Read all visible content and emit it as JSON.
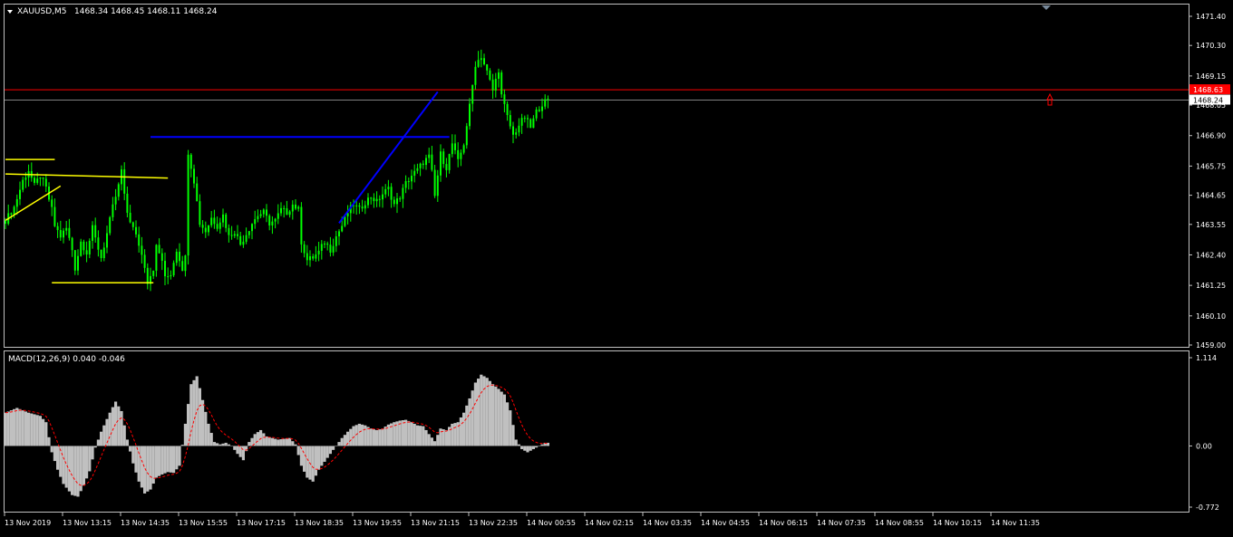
{
  "header": {
    "symbol": "XAUUSD,M5",
    "ohlc": "1468.34 1468.45 1468.11 1468.24"
  },
  "macd_header": {
    "label": "MACD(12,26,9) 0.040 -0.046"
  },
  "colors": {
    "background": "#000000",
    "frame": "#c0c0c0",
    "candle": "#00ff00",
    "yellow_lines": "#ffff00",
    "blue_lines": "#0000ff",
    "ask_line": "#ff0000",
    "hist": "#c0c0c0",
    "signal": "#ff0000"
  },
  "price_axis": {
    "ticks": [
      "1471.40",
      "1470.30",
      "1469.15",
      "1468.05",
      "1466.90",
      "1465.75",
      "1464.65",
      "1463.55",
      "1462.40",
      "1461.25",
      "1460.10",
      "1459.00"
    ],
    "bid_label": "1468.24",
    "ask_label": "1468.63",
    "bid": 1468.24,
    "ask": 1468.63
  },
  "macd_axis": {
    "ticks": [
      "1.114",
      "0.00",
      "-0.772"
    ],
    "max": 1.114,
    "min": -0.772
  },
  "time_axis": {
    "labels": [
      "13 Nov 2019",
      "13 Nov 13:15",
      "13 Nov 14:35",
      "13 Nov 15:55",
      "13 Nov 17:15",
      "13 Nov 18:35",
      "13 Nov 19:55",
      "13 Nov 21:15",
      "13 Nov 22:35",
      "14 Nov 00:55",
      "14 Nov 02:15",
      "14 Nov 03:35",
      "14 Nov 04:55",
      "14 Nov 06:15",
      "14 Nov 07:35",
      "14 Nov 08:55",
      "14 Nov 10:15",
      "14 Nov 11:35"
    ]
  },
  "chart_data": {
    "type": "candlestick",
    "price_range": [
      1459.0,
      1471.4
    ],
    "close_path": [
      [
        0,
        1463.7
      ],
      [
        3,
        1464.2
      ],
      [
        6,
        1465.2
      ],
      [
        8,
        1465.6
      ],
      [
        10,
        1465.0
      ],
      [
        12,
        1465.4
      ],
      [
        14,
        1464.9
      ],
      [
        16,
        1464.1
      ],
      [
        17,
        1463.5
      ],
      [
        19,
        1463.1
      ],
      [
        21,
        1463.4
      ],
      [
        23,
        1462.6
      ],
      [
        24,
        1461.9
      ],
      [
        26,
        1462.9
      ],
      [
        28,
        1462.5
      ],
      [
        30,
        1463.4
      ],
      [
        31,
        1463.0
      ],
      [
        33,
        1462.3
      ],
      [
        35,
        1463.2
      ],
      [
        37,
        1464.2
      ],
      [
        39,
        1465.0
      ],
      [
        40,
        1465.6
      ],
      [
        41,
        1464.6
      ],
      [
        42,
        1464.0
      ],
      [
        44,
        1463.4
      ],
      [
        46,
        1462.8
      ],
      [
        48,
        1462.0
      ],
      [
        49,
        1461.4
      ],
      [
        51,
        1461.9
      ],
      [
        52,
        1462.7
      ],
      [
        54,
        1462.2
      ],
      [
        55,
        1461.5
      ],
      [
        57,
        1461.7
      ],
      [
        59,
        1462.6
      ],
      [
        61,
        1461.9
      ],
      [
        62,
        1462.3
      ],
      [
        63,
        1466.3
      ],
      [
        65,
        1465.2
      ],
      [
        67,
        1463.6
      ],
      [
        69,
        1463.3
      ],
      [
        71,
        1463.8
      ],
      [
        73,
        1463.5
      ],
      [
        75,
        1463.9
      ],
      [
        77,
        1463.1
      ],
      [
        79,
        1463.3
      ],
      [
        81,
        1462.8
      ],
      [
        83,
        1463.2
      ],
      [
        85,
        1463.6
      ],
      [
        87,
        1463.9
      ],
      [
        89,
        1464.0
      ],
      [
        91,
        1463.6
      ],
      [
        93,
        1463.7
      ],
      [
        95,
        1464.1
      ],
      [
        97,
        1464.0
      ],
      [
        99,
        1464.3
      ],
      [
        101,
        1464.1
      ],
      [
        102,
        1462.9
      ],
      [
        104,
        1462.2
      ],
      [
        106,
        1462.3
      ],
      [
        108,
        1462.5
      ],
      [
        110,
        1462.9
      ],
      [
        112,
        1462.6
      ],
      [
        114,
        1463.1
      ],
      [
        116,
        1463.5
      ],
      [
        118,
        1464.0
      ],
      [
        120,
        1464.3
      ],
      [
        122,
        1464.1
      ],
      [
        124,
        1464.4
      ],
      [
        126,
        1464.6
      ],
      [
        128,
        1464.4
      ],
      [
        130,
        1464.7
      ],
      [
        132,
        1464.9
      ],
      [
        134,
        1464.3
      ],
      [
        136,
        1464.6
      ],
      [
        138,
        1465.1
      ],
      [
        140,
        1465.4
      ],
      [
        142,
        1465.6
      ],
      [
        144,
        1465.9
      ],
      [
        146,
        1466.1
      ],
      [
        147,
        1465.5
      ],
      [
        148,
        1464.6
      ],
      [
        150,
        1466.2
      ],
      [
        152,
        1465.7
      ],
      [
        154,
        1466.6
      ],
      [
        156,
        1465.9
      ],
      [
        158,
        1466.6
      ],
      [
        160,
        1468.0
      ],
      [
        162,
        1469.6
      ],
      [
        164,
        1469.9
      ],
      [
        166,
        1469.3
      ],
      [
        168,
        1468.6
      ],
      [
        170,
        1469.4
      ],
      [
        171,
        1468.4
      ],
      [
        173,
        1467.6
      ],
      [
        175,
        1466.9
      ],
      [
        177,
        1467.3
      ],
      [
        179,
        1467.6
      ],
      [
        181,
        1467.2
      ],
      [
        183,
        1467.8
      ],
      [
        185,
        1468.1
      ],
      [
        187,
        1468.24
      ]
    ],
    "macd_hist_path": [
      [
        0,
        0.42
      ],
      [
        4,
        0.48
      ],
      [
        8,
        0.42
      ],
      [
        12,
        0.38
      ],
      [
        14,
        0.3
      ],
      [
        16,
        -0.08
      ],
      [
        18,
        -0.3
      ],
      [
        20,
        -0.48
      ],
      [
        23,
        -0.62
      ],
      [
        25,
        -0.64
      ],
      [
        27,
        -0.5
      ],
      [
        29,
        -0.32
      ],
      [
        31,
        -0.02
      ],
      [
        33,
        0.18
      ],
      [
        36,
        0.42
      ],
      [
        38,
        0.56
      ],
      [
        40,
        0.44
      ],
      [
        42,
        0.08
      ],
      [
        44,
        -0.22
      ],
      [
        46,
        -0.45
      ],
      [
        48,
        -0.6
      ],
      [
        50,
        -0.55
      ],
      [
        52,
        -0.4
      ],
      [
        54,
        -0.36
      ],
      [
        56,
        -0.33
      ],
      [
        58,
        -0.34
      ],
      [
        60,
        -0.25
      ],
      [
        62,
        0.28
      ],
      [
        64,
        0.78
      ],
      [
        66,
        0.88
      ],
      [
        68,
        0.58
      ],
      [
        70,
        0.28
      ],
      [
        72,
        0.05
      ],
      [
        74,
        0.02
      ],
      [
        76,
        0.04
      ],
      [
        78,
        0.0
      ],
      [
        80,
        -0.1
      ],
      [
        82,
        -0.18
      ],
      [
        84,
        0.05
      ],
      [
        86,
        0.15
      ],
      [
        88,
        0.2
      ],
      [
        90,
        0.12
      ],
      [
        92,
        0.1
      ],
      [
        94,
        0.08
      ],
      [
        96,
        0.09
      ],
      [
        98,
        0.1
      ],
      [
        100,
        0.02
      ],
      [
        102,
        -0.25
      ],
      [
        104,
        -0.4
      ],
      [
        106,
        -0.45
      ],
      [
        108,
        -0.3
      ],
      [
        110,
        -0.2
      ],
      [
        112,
        -0.1
      ],
      [
        114,
        0.0
      ],
      [
        116,
        0.1
      ],
      [
        118,
        0.18
      ],
      [
        120,
        0.25
      ],
      [
        122,
        0.28
      ],
      [
        124,
        0.26
      ],
      [
        126,
        0.22
      ],
      [
        128,
        0.2
      ],
      [
        130,
        0.22
      ],
      [
        132,
        0.27
      ],
      [
        134,
        0.3
      ],
      [
        136,
        0.32
      ],
      [
        138,
        0.33
      ],
      [
        140,
        0.3
      ],
      [
        142,
        0.26
      ],
      [
        144,
        0.25
      ],
      [
        146,
        0.15
      ],
      [
        148,
        0.06
      ],
      [
        150,
        0.22
      ],
      [
        152,
        0.2
      ],
      [
        154,
        0.28
      ],
      [
        156,
        0.3
      ],
      [
        158,
        0.42
      ],
      [
        160,
        0.6
      ],
      [
        162,
        0.8
      ],
      [
        164,
        0.9
      ],
      [
        166,
        0.86
      ],
      [
        168,
        0.78
      ],
      [
        170,
        0.72
      ],
      [
        172,
        0.65
      ],
      [
        174,
        0.45
      ],
      [
        176,
        0.08
      ],
      [
        178,
        -0.04
      ],
      [
        180,
        -0.08
      ],
      [
        182,
        -0.04
      ],
      [
        184,
        0.0
      ],
      [
        186,
        0.04
      ]
    ],
    "yellow_lines": [
      [
        [
          0,
          1466.0
        ],
        [
          17,
          1466.0
        ]
      ],
      [
        [
          0,
          1465.45
        ],
        [
          56,
          1465.3
        ]
      ],
      [
        [
          0,
          1463.7
        ],
        [
          19,
          1465.0
        ]
      ],
      [
        [
          16,
          1461.35
        ],
        [
          51,
          1461.35
        ]
      ]
    ],
    "blue_lines": [
      [
        [
          50,
          1466.85
        ],
        [
          153,
          1466.85
        ]
      ],
      [
        [
          115,
          1463.6
        ],
        [
          149,
          1468.55
        ]
      ]
    ]
  }
}
